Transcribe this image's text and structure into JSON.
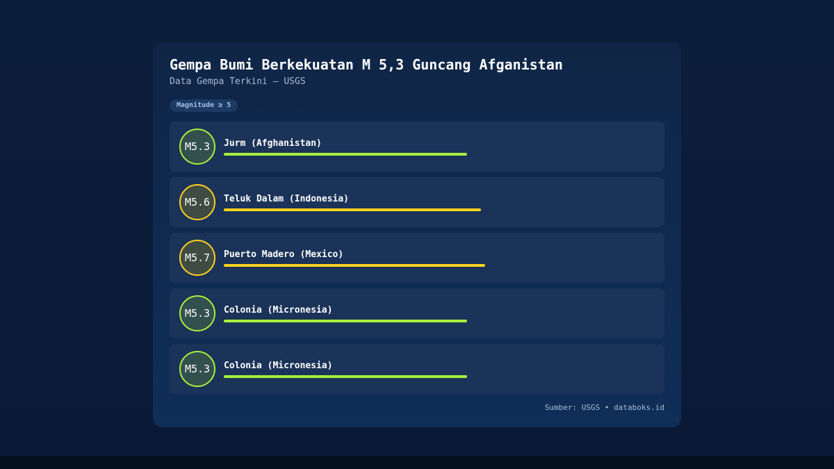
{
  "title": "Gempa Bumi Berkekuatan M 5,3 Guncang Afganistan",
  "subtitle": "Data Gempa Terkini — USGS",
  "badge": "Magnitude ≥ 5",
  "source": "Sumber: USGS • databoks.id",
  "colors": {
    "low": "#a6f23c",
    "high": "#ffd21f",
    "circle_fill_low": "#34504e",
    "circle_fill_high": "#3f4c43"
  },
  "chart_data": {
    "type": "bar",
    "title": "Gempa Bumi Berkekuatan M 5,3 Guncang Afganistan",
    "subtitle": "Data Gempa Terkini — USGS",
    "categories": [
      "Jurm (Afghanistan)",
      "Teluk Dalam (Indonesia)",
      "Puerto Madero (Mexico)",
      "Colonia (Micronesia)",
      "Colonia (Micronesia)"
    ],
    "values": [
      5.3,
      5.6,
      5.7,
      5.3,
      5.3
    ],
    "value_labels": [
      "M5.3",
      "M5.6",
      "M5.7",
      "M5.3",
      "M5.3"
    ],
    "xlim": [
      0,
      9
    ],
    "grid": false,
    "legend": "none"
  }
}
